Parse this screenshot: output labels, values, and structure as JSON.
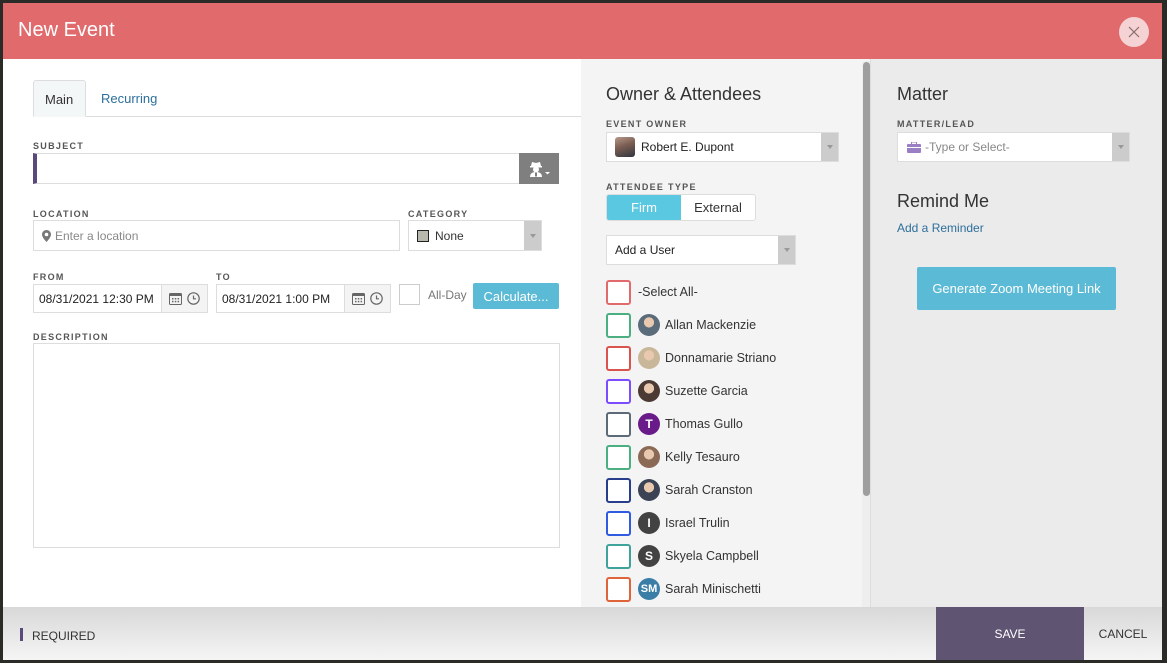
{
  "header": {
    "title": "New Event",
    "close_icon": "close-icon"
  },
  "tabs": [
    {
      "label": "Main",
      "active": true
    },
    {
      "label": "Recurring",
      "active": false
    }
  ],
  "form": {
    "subject_label": "SUBJECT",
    "subject_value": "",
    "location_label": "LOCATION",
    "location_placeholder": "Enter a location",
    "category_label": "CATEGORY",
    "category_value": "None",
    "category_color": "#b8b8ad",
    "from_label": "FROM",
    "from_value": "08/31/2021 12:30 PM",
    "to_label": "TO",
    "to_value": "08/31/2021 1:00 PM",
    "allday_label": "All-Day",
    "allday_checked": false,
    "calculate_label": "Calculate...",
    "description_label": "DESCRIPTION",
    "description_value": ""
  },
  "attendees": {
    "section_title": "Owner & Attendees",
    "owner_label": "EVENT OWNER",
    "owner_value": "Robert E. Dupont",
    "type_label": "ATTENDEE TYPE",
    "type_options": [
      "Firm",
      "External"
    ],
    "type_selected": "Firm",
    "add_user_label": "Add a User",
    "select_all_label": "-Select All-",
    "select_all_color": "#e06a6c",
    "list": [
      {
        "name": "Allan Mackenzie",
        "avatar": "photo",
        "initials": "",
        "box_color": "#4caf82",
        "avatar_color": "#5a6b7a"
      },
      {
        "name": "Donnamarie Striano",
        "avatar": "photo",
        "initials": "",
        "box_color": "#d9534f",
        "avatar_color": "#c9b79a"
      },
      {
        "name": "Suzette Garcia",
        "avatar": "photo",
        "initials": "",
        "box_color": "#7c4dff",
        "avatar_color": "#4b3a33"
      },
      {
        "name": "Thomas Gullo",
        "avatar": "initials",
        "initials": "T",
        "box_color": "#5d6b78",
        "avatar_color": "#6a1b8a"
      },
      {
        "name": "Kelly Tesauro",
        "avatar": "photo",
        "initials": "",
        "box_color": "#4caf82",
        "avatar_color": "#8a6a55"
      },
      {
        "name": "Sarah Cranston",
        "avatar": "photo",
        "initials": "",
        "box_color": "#283e8c",
        "avatar_color": "#3a4254"
      },
      {
        "name": "Israel Trulin",
        "avatar": "initials",
        "initials": "I",
        "box_color": "#2f5be0",
        "avatar_color": "#424242"
      },
      {
        "name": "Skyela Campbell",
        "avatar": "initials",
        "initials": "S",
        "box_color": "#3fa39b",
        "avatar_color": "#424242"
      },
      {
        "name": "Sarah Minischetti",
        "avatar": "initials",
        "initials": "SM",
        "box_color": "#e0643a",
        "avatar_color": "#3a7ea8"
      }
    ]
  },
  "matter": {
    "section_title": "Matter",
    "field_label": "MATTER/LEAD",
    "placeholder": "-Type or Select-",
    "remind_title": "Remind Me",
    "add_reminder_label": "Add a Reminder",
    "zoom_button_label": "Generate Zoom Meeting Link"
  },
  "footer": {
    "required_label": "REQUIRED",
    "save_label": "SAVE",
    "cancel_label": "CANCEL"
  },
  "colors": {
    "header": "#e06a6c",
    "accent": "#5bbad5",
    "required": "#5a4a7c",
    "save": "#5f5573"
  }
}
